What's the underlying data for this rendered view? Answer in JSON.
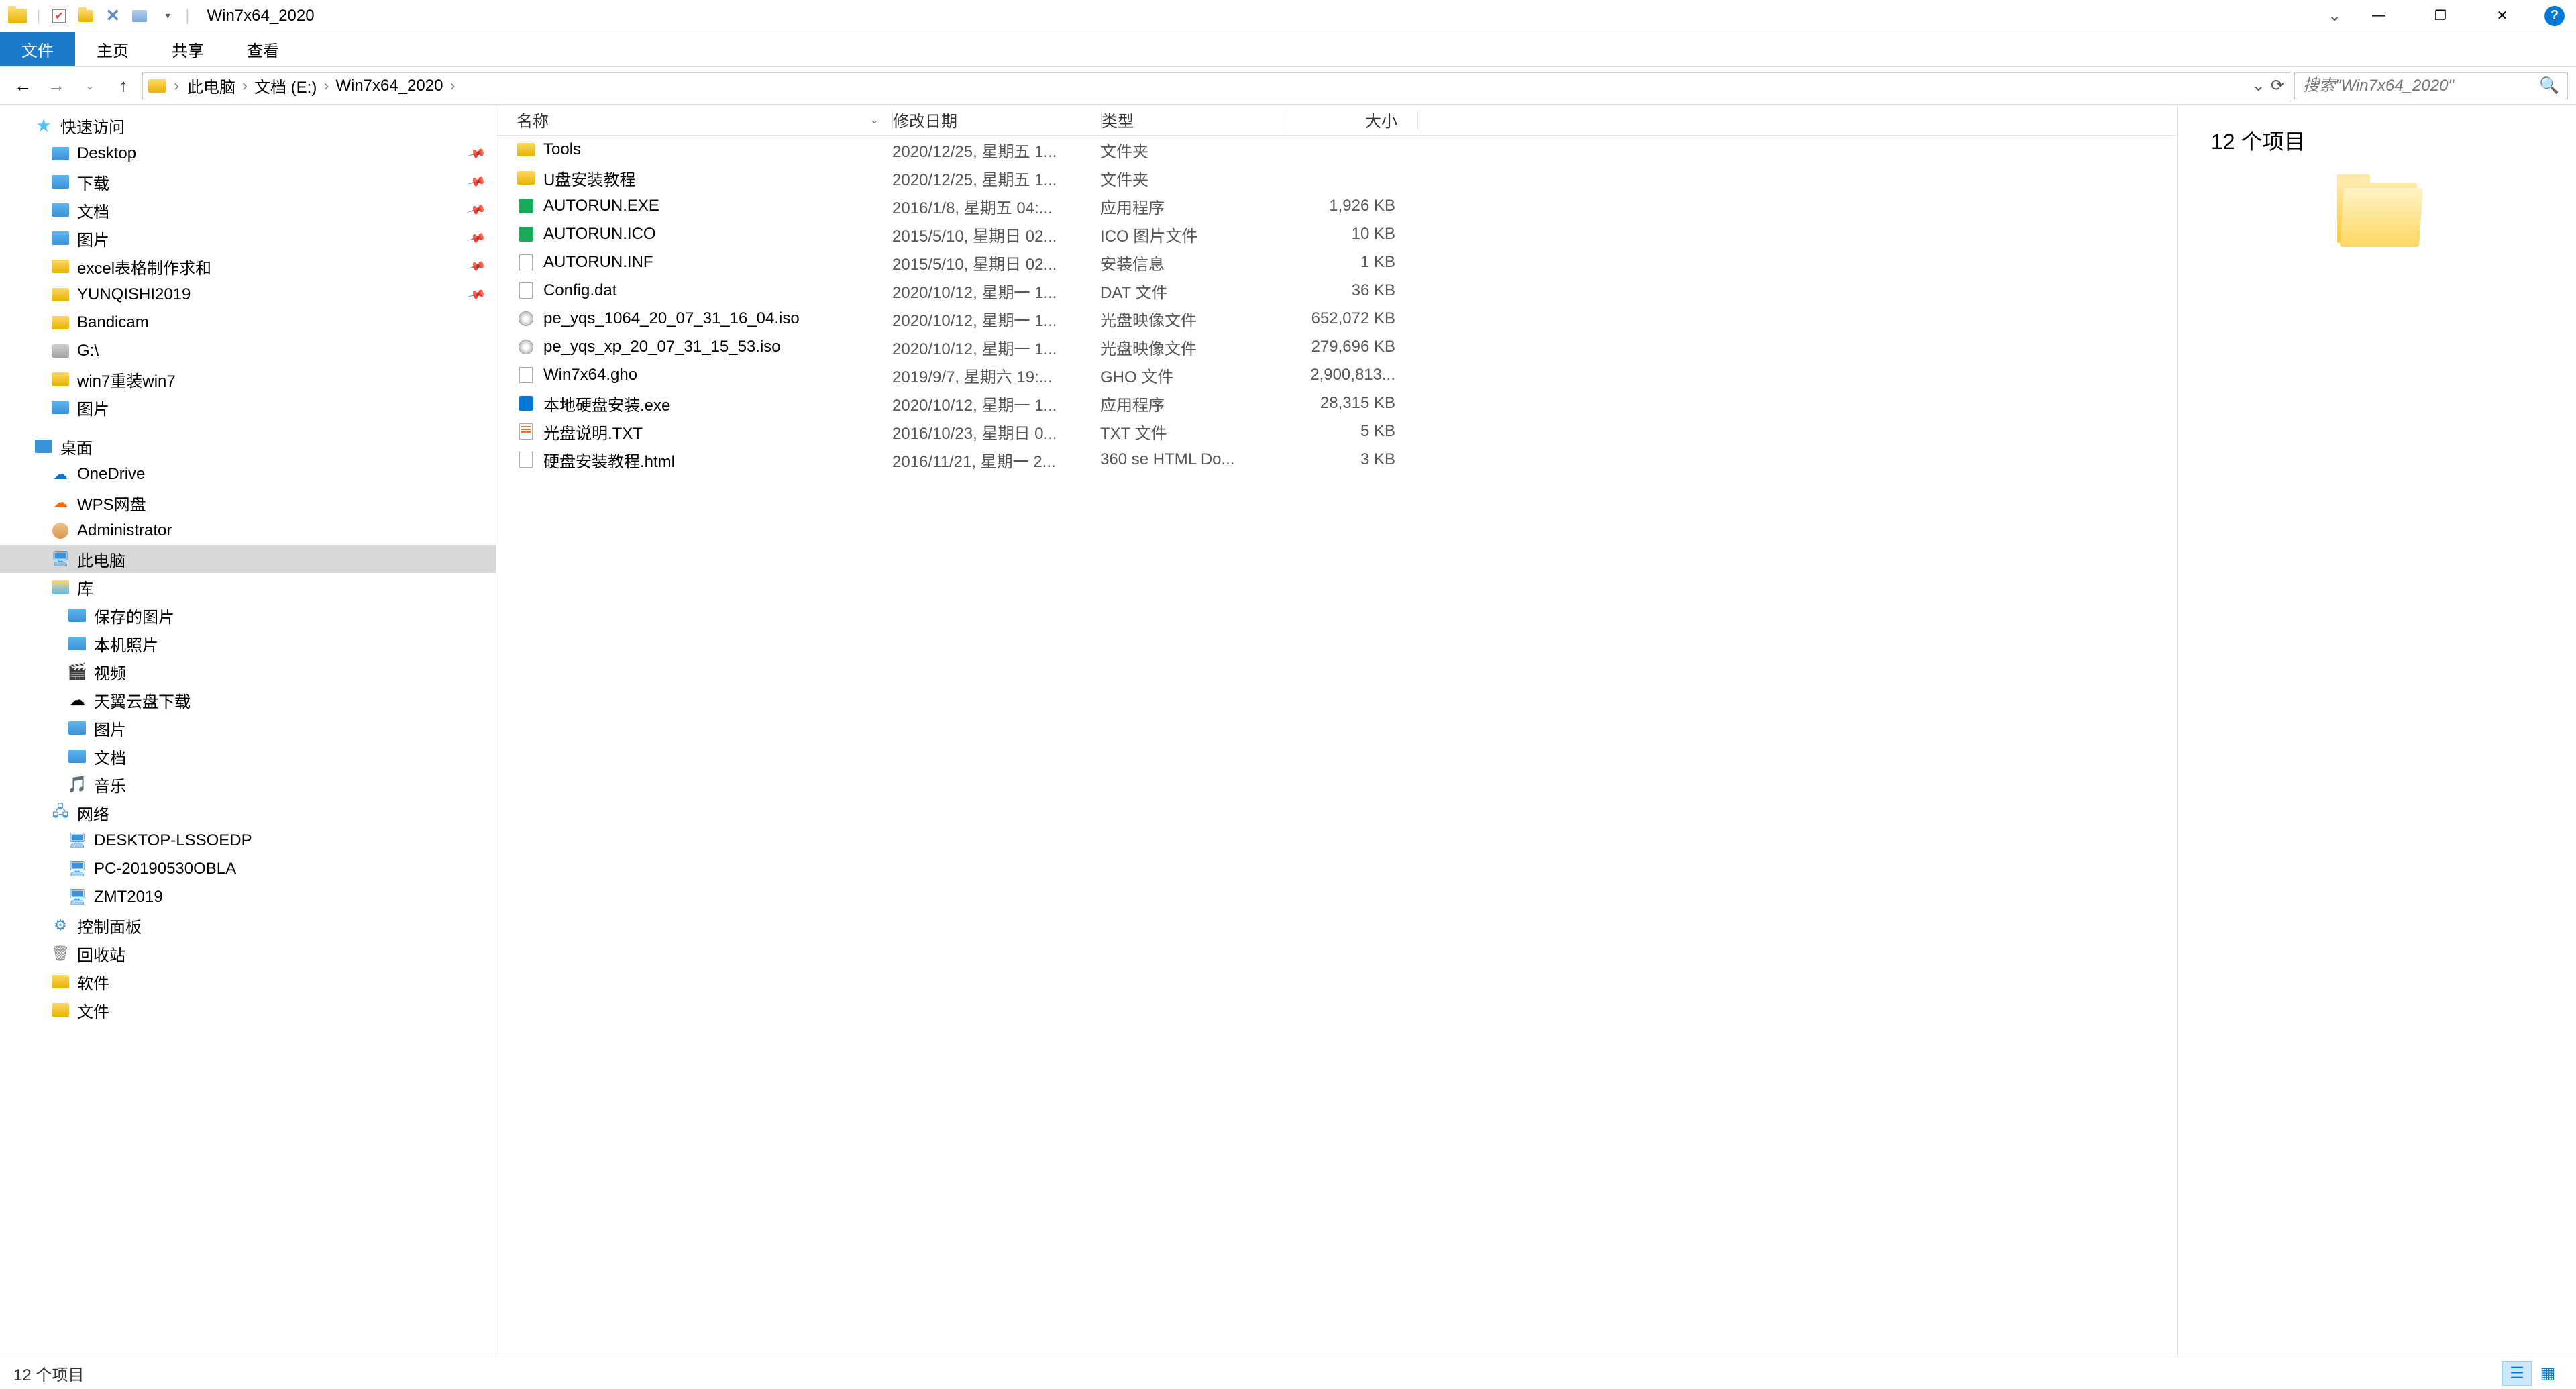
{
  "window": {
    "title": "Win7x64_2020"
  },
  "ribbon": {
    "file": "文件",
    "home": "主页",
    "share": "共享",
    "view": "查看"
  },
  "breadcrumb": {
    "items": [
      "此电脑",
      "文档 (E:)",
      "Win7x64_2020"
    ]
  },
  "search": {
    "placeholder": "搜索\"Win7x64_2020\""
  },
  "tree": {
    "quick_access": "快速访问",
    "desktop": "Desktop",
    "downloads": "下载",
    "documents": "文档",
    "pictures": "图片",
    "excel": "excel表格制作求和",
    "yunqishi": "YUNQISHI2019",
    "bandicam": "Bandicam",
    "g_drive": "G:\\",
    "win7reinstall": "win7重装win7",
    "pictures2": "图片",
    "desktop_root": "桌面",
    "onedrive": "OneDrive",
    "wps": "WPS网盘",
    "admin": "Administrator",
    "this_pc": "此电脑",
    "libraries": "库",
    "saved_pics": "保存的图片",
    "camera_roll": "本机照片",
    "videos": "视频",
    "tycloud": "天翼云盘下载",
    "lib_pics": "图片",
    "lib_docs": "文档",
    "lib_music": "音乐",
    "network": "网络",
    "desktop_lssoedp": "DESKTOP-LSSOEDP",
    "pc_2019": "PC-20190530OBLA",
    "zmt": "ZMT2019",
    "control_panel": "控制面板",
    "recycle": "回收站",
    "software": "软件",
    "files": "文件"
  },
  "columns": {
    "name": "名称",
    "date": "修改日期",
    "type": "类型",
    "size": "大小"
  },
  "files": [
    {
      "name": "Tools",
      "date": "2020/12/25, 星期五 1...",
      "type": "文件夹",
      "size": "",
      "icon": "folder"
    },
    {
      "name": "U盘安装教程",
      "date": "2020/12/25, 星期五 1...",
      "type": "文件夹",
      "size": "",
      "icon": "folder"
    },
    {
      "name": "AUTORUN.EXE",
      "date": "2016/1/8, 星期五 04:...",
      "type": "应用程序",
      "size": "1,926 KB",
      "icon": "exe"
    },
    {
      "name": "AUTORUN.ICO",
      "date": "2015/5/10, 星期日 02...",
      "type": "ICO 图片文件",
      "size": "10 KB",
      "icon": "ico"
    },
    {
      "name": "AUTORUN.INF",
      "date": "2015/5/10, 星期日 02...",
      "type": "安装信息",
      "size": "1 KB",
      "icon": "txt"
    },
    {
      "name": "Config.dat",
      "date": "2020/10/12, 星期一 1...",
      "type": "DAT 文件",
      "size": "36 KB",
      "icon": "txt"
    },
    {
      "name": "pe_yqs_1064_20_07_31_16_04.iso",
      "date": "2020/10/12, 星期一 1...",
      "type": "光盘映像文件",
      "size": "652,072 KB",
      "icon": "iso"
    },
    {
      "name": "pe_yqs_xp_20_07_31_15_53.iso",
      "date": "2020/10/12, 星期一 1...",
      "type": "光盘映像文件",
      "size": "279,696 KB",
      "icon": "iso"
    },
    {
      "name": "Win7x64.gho",
      "date": "2019/9/7, 星期六 19:...",
      "type": "GHO 文件",
      "size": "2,900,813...",
      "icon": "gho"
    },
    {
      "name": "本地硬盘安装.exe",
      "date": "2020/10/12, 星期一 1...",
      "type": "应用程序",
      "size": "28,315 KB",
      "icon": "exe2"
    },
    {
      "name": "光盘说明.TXT",
      "date": "2016/10/23, 星期日 0...",
      "type": "TXT 文件",
      "size": "5 KB",
      "icon": "txt2"
    },
    {
      "name": "硬盘安装教程.html",
      "date": "2016/11/21, 星期一 2...",
      "type": "360 se HTML Do...",
      "size": "3 KB",
      "icon": "html"
    }
  ],
  "preview": {
    "title": "12 个项目"
  },
  "status": {
    "text": "12 个项目"
  }
}
